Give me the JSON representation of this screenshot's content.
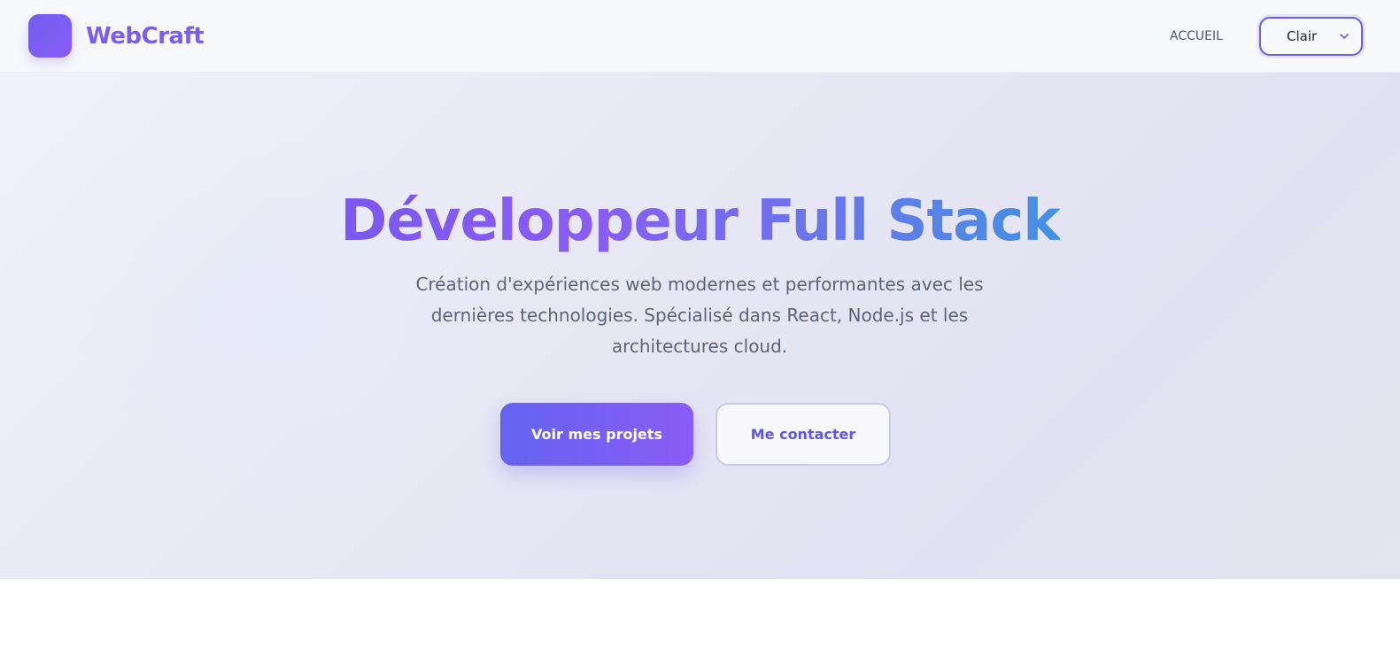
{
  "brand": {
    "name": "WebCraft",
    "logo_icon": "logo-square-icon",
    "accent_color": "#7b5cf0"
  },
  "nav": {
    "links": [
      "ACCUEIL"
    ]
  },
  "theme_select": {
    "value": "Clair",
    "icon": "chevron-down-icon"
  },
  "hero": {
    "title": "Développeur Full Stack",
    "subtitle": "Création d'expériences web modernes et performantes avec les dernières technologies. Spécialisé dans React, Node.js et les architectures cloud.",
    "primary_button": "Voir mes projets",
    "secondary_button": "Me contacter",
    "gradient_colors": [
      "#7a58ef",
      "#8a5cf6",
      "#6678ea",
      "#4391e3"
    ]
  }
}
